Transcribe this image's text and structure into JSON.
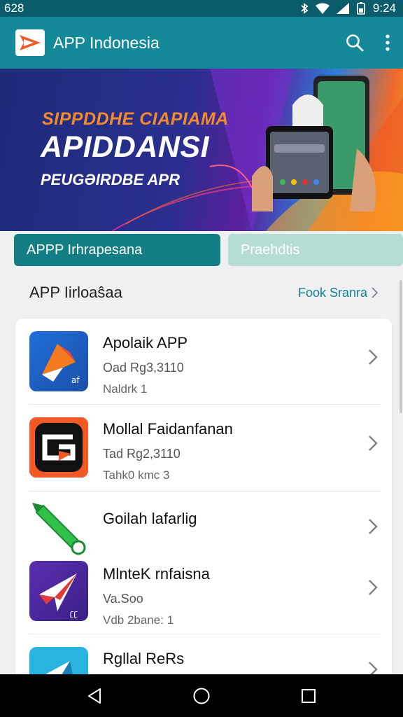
{
  "status_bar": {
    "time_left": "628",
    "time_right": "9:24"
  },
  "app_bar": {
    "title": "APP Indonesia"
  },
  "banner": {
    "line1": "SIPPDDHE CIAPIAMA",
    "line2": "APIDDANSI",
    "line3": "PEUGƏIRDBE APR"
  },
  "tabs": [
    {
      "label": "APPP Irhrapesana"
    },
    {
      "label": "Praehdtis"
    }
  ],
  "section": {
    "title": "APP Iirloaŝaa",
    "link": "Fook Sranra"
  },
  "apps": [
    {
      "name": "Apolaik APP",
      "line1": "Oad Rg3,3110",
      "line2": "Naldrk 1",
      "icon": "arrow-logo-icon"
    },
    {
      "name": "Mollal Faidanfanan",
      "line1": "Tad Rg2,3110",
      "line2": "Tahk0 kmc 3",
      "icon": "g-logo-icon"
    },
    {
      "name": "Goilah lafarlig",
      "line1": "",
      "line2": "",
      "icon": "green-pen-icon"
    },
    {
      "name": "MlnteK rnfaisna",
      "line1": "Va.Soo",
      "line2": "Vdb 2bane: 1",
      "icon": "paper-plane-icon"
    },
    {
      "name": "Rgllal ReRs",
      "line1": "",
      "line2": "",
      "icon": "blue-logo-icon"
    }
  ],
  "colors": {
    "primary": "#14899a",
    "status": "#0a5c6b",
    "tab_active": "#137f84",
    "tab_inactive": "#b5ddd3",
    "accent_text": "#16808e"
  }
}
